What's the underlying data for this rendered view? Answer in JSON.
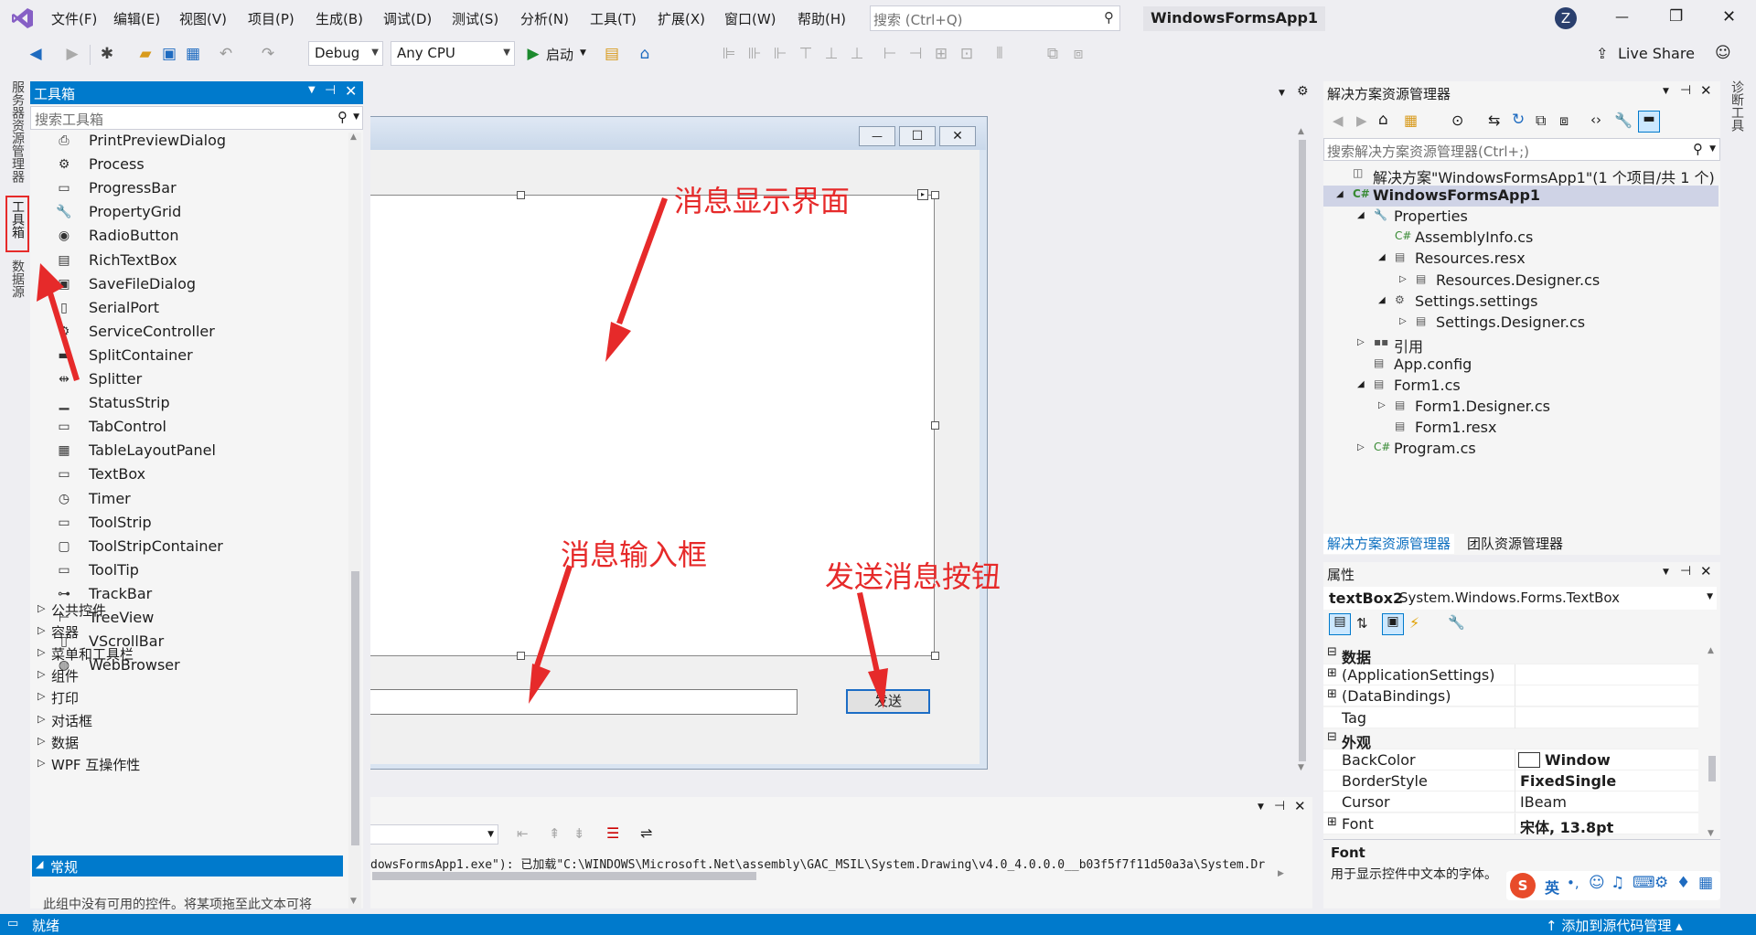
{
  "menubar": {
    "items": [
      "文件(F)",
      "编辑(E)",
      "视图(V)",
      "项目(P)",
      "生成(B)",
      "调试(D)",
      "测试(S)",
      "分析(N)",
      "工具(T)",
      "扩展(X)",
      "窗口(W)",
      "帮助(H)"
    ],
    "search_placeholder": "搜索 (Ctrl+Q)",
    "solution_title": "WindowsFormsApp1",
    "user_initial": "Z",
    "win_min": "—",
    "win_restore": "❐",
    "win_close": "✕"
  },
  "toolbar": {
    "config": "Debug",
    "platform": "Any CPU",
    "start_label": "启动",
    "live_share": "Live Share"
  },
  "left_tabs": {
    "server_explorer": "服务器资源管理器",
    "toolbox": "工具箱",
    "data_sources": "数据源"
  },
  "toolbox": {
    "title": "工具箱",
    "search_placeholder": "搜索工具箱",
    "items": [
      {
        "icon": "⎙",
        "label": "PrintPreviewDialog"
      },
      {
        "icon": "⚙",
        "label": "Process"
      },
      {
        "icon": "▭",
        "label": "ProgressBar"
      },
      {
        "icon": "🔧",
        "label": "PropertyGrid"
      },
      {
        "icon": "◉",
        "label": "RadioButton"
      },
      {
        "icon": "▤",
        "label": "RichTextBox"
      },
      {
        "icon": "▣",
        "label": "SaveFileDialog"
      },
      {
        "icon": "▯",
        "label": "SerialPort"
      },
      {
        "icon": "⚙",
        "label": "ServiceController"
      },
      {
        "icon": "▬",
        "label": "SplitContainer"
      },
      {
        "icon": "⇹",
        "label": "Splitter"
      },
      {
        "icon": "▁",
        "label": "StatusStrip"
      },
      {
        "icon": "▭",
        "label": "TabControl"
      },
      {
        "icon": "▦",
        "label": "TableLayoutPanel"
      },
      {
        "icon": "▭",
        "label": "TextBox"
      },
      {
        "icon": "◷",
        "label": "Timer"
      },
      {
        "icon": "▭",
        "label": "ToolStrip"
      },
      {
        "icon": "▢",
        "label": "ToolStripContainer"
      },
      {
        "icon": "▭",
        "label": "ToolTip"
      },
      {
        "icon": "⊶",
        "label": "TrackBar"
      },
      {
        "icon": "⊢",
        "label": "TreeView"
      },
      {
        "icon": "▯",
        "label": "VScrollBar"
      },
      {
        "icon": "◍",
        "label": "WebBrowser"
      }
    ],
    "categories": [
      "公共控件",
      "容器",
      "菜单和工具栏",
      "组件",
      "打印",
      "对话框",
      "数据",
      "WPF 互操作性"
    ],
    "general": "常规",
    "empty_note": "此组中没有可用的控件。将某项拖至此文本可将"
  },
  "designer": {
    "send_button": "发送",
    "window_min": "—",
    "window_max": "☐",
    "window_close": "✕"
  },
  "annotations": {
    "display": "消息显示界面",
    "input": "消息输入框",
    "send": "发送消息按钮"
  },
  "output": {
    "text": "dowsFormsApp1.exe\"): 已加载\"C:\\WINDOWS\\Microsoft.Net\\assembly\\GAC_MSIL\\System.Drawing\\v4.0_4.0.0.0__b03f5f7f11d50a3a\\System.Dr"
  },
  "solution_explorer": {
    "title": "解决方案资源管理器",
    "search_placeholder": "搜索解决方案资源管理器(Ctrl+;)",
    "rows": [
      {
        "icon": "◫",
        "text": "解决方案\"WindowsFormsApp1\"(1 个项目/共 1 个)",
        "arrow": ""
      },
      {
        "icon": "C#",
        "text": "WindowsFormsApp1",
        "arrow": "◢"
      },
      {
        "icon": "🔧",
        "text": "Properties",
        "arrow": "◢"
      },
      {
        "icon": "C#",
        "text": "AssemblyInfo.cs",
        "arrow": ""
      },
      {
        "icon": "▤",
        "text": "Resources.resx",
        "arrow": "◢"
      },
      {
        "icon": "▤",
        "text": "Resources.Designer.cs",
        "arrow": "▷"
      },
      {
        "icon": "⚙",
        "text": "Settings.settings",
        "arrow": "◢"
      },
      {
        "icon": "▤",
        "text": "Settings.Designer.cs",
        "arrow": "▷"
      },
      {
        "icon": "▪▪",
        "text": "引用",
        "arrow": "▷"
      },
      {
        "icon": "▤",
        "text": "App.config",
        "arrow": ""
      },
      {
        "icon": "▤",
        "text": "Form1.cs",
        "arrow": "◢"
      },
      {
        "icon": "▤",
        "text": "Form1.Designer.cs",
        "arrow": "▷"
      },
      {
        "icon": "▤",
        "text": "Form1.resx",
        "arrow": ""
      },
      {
        "icon": "C#",
        "text": "Program.cs",
        "arrow": "▷"
      }
    ],
    "tab_solution": "解决方案资源管理器",
    "tab_team": "团队资源管理器"
  },
  "properties": {
    "title": "属性",
    "object_name": "textBox2",
    "object_type": "System.Windows.Forms.TextBox",
    "rows": [
      {
        "kind": "cat",
        "name": "数据",
        "value": ""
      },
      {
        "kind": "exp",
        "name": "(ApplicationSettings)",
        "value": ""
      },
      {
        "kind": "exp",
        "name": "(DataBindings)",
        "value": ""
      },
      {
        "kind": "prop",
        "name": "Tag",
        "value": ""
      },
      {
        "kind": "cat",
        "name": "外观",
        "value": ""
      },
      {
        "kind": "prop",
        "name": "BackColor",
        "value": "Window"
      },
      {
        "kind": "prop",
        "name": "BorderStyle",
        "value": "FixedSingle"
      },
      {
        "kind": "prop",
        "name": "Cursor",
        "value": "IBeam"
      },
      {
        "kind": "exp",
        "name": "Font",
        "value": "宋体, 13.8pt"
      }
    ],
    "desc_title": "Font",
    "desc_text": "用于显示控件中文本的字体。"
  },
  "ime": {
    "lang": "英"
  },
  "status": {
    "text": "就绪",
    "right": "↑ 添加到源代码管理 ▴"
  },
  "right_tab": {
    "diagnostics": "诊断工具"
  },
  "colors": {
    "accent": "#007acc",
    "annotation": "#e62a2a",
    "selected": "#cce8ff"
  }
}
